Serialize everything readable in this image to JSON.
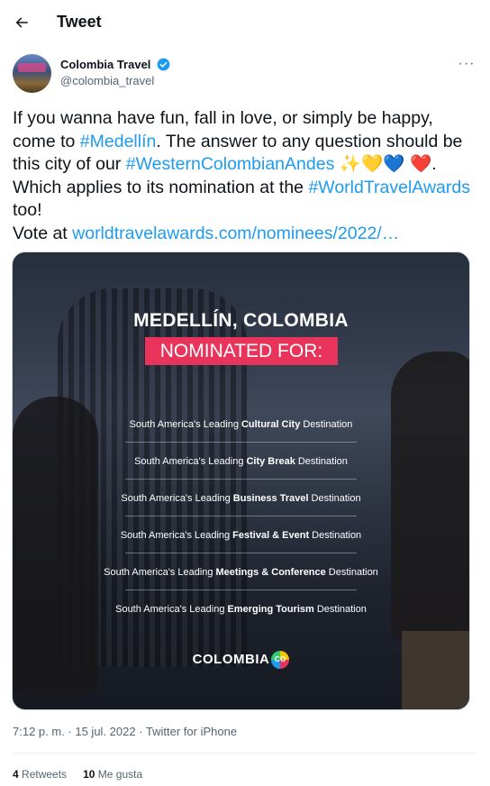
{
  "header": {
    "title": "Tweet"
  },
  "author": {
    "name": "Colombia Travel",
    "handle": "@colombia_travel",
    "verified_color": "#1d9bf0"
  },
  "tweet": {
    "segments": [
      {
        "text": "If you wanna have fun, fall in love, or simply be happy, come to ",
        "link": false
      },
      {
        "text": "#Medellín",
        "link": true
      },
      {
        "text": ". The answer to any question should be this city of our ",
        "link": false
      },
      {
        "text": "#WesternColombianAndes",
        "link": true
      },
      {
        "text": " ✨💛💙 ❤️. Which applies to its nomination at the ",
        "link": false
      },
      {
        "text": "#WorldTravelAwards",
        "link": true
      },
      {
        "text": " too!\nVote at ",
        "link": false
      },
      {
        "text": "worldtravelawards.com/nominees/2022/…",
        "link": true
      }
    ]
  },
  "media": {
    "title": "MEDELLÍN, COLOMBIA",
    "subtitle": "NOMINATED FOR:",
    "nominations": [
      {
        "pre": "South America's Leading",
        "bold": "Cultural City",
        "post": "Destination"
      },
      {
        "pre": "South America's Leading",
        "bold": "City Break",
        "post": "Destination"
      },
      {
        "pre": "South America's Leading",
        "bold": "Business Travel",
        "post": "Destination"
      },
      {
        "pre": "South America's Leading",
        "bold": "Festival & Event",
        "post": "Destination"
      },
      {
        "pre": "South America's Leading",
        "bold": "Meetings & Conference",
        "post": "Destination"
      },
      {
        "pre": "South America's Leading",
        "bold": "Emerging Tourism",
        "post": "Destination"
      }
    ],
    "logo_text": "COLOMBIA",
    "logo_mark": "CO",
    "accent_color": "#e8345a"
  },
  "meta": {
    "timestamp": "7:12 p. m. · 15 jul. 2022 · Twitter for iPhone"
  },
  "stats": {
    "retweets_count": "4",
    "retweets_label": "Retweets",
    "likes_count": "10",
    "likes_label": "Me gusta"
  }
}
